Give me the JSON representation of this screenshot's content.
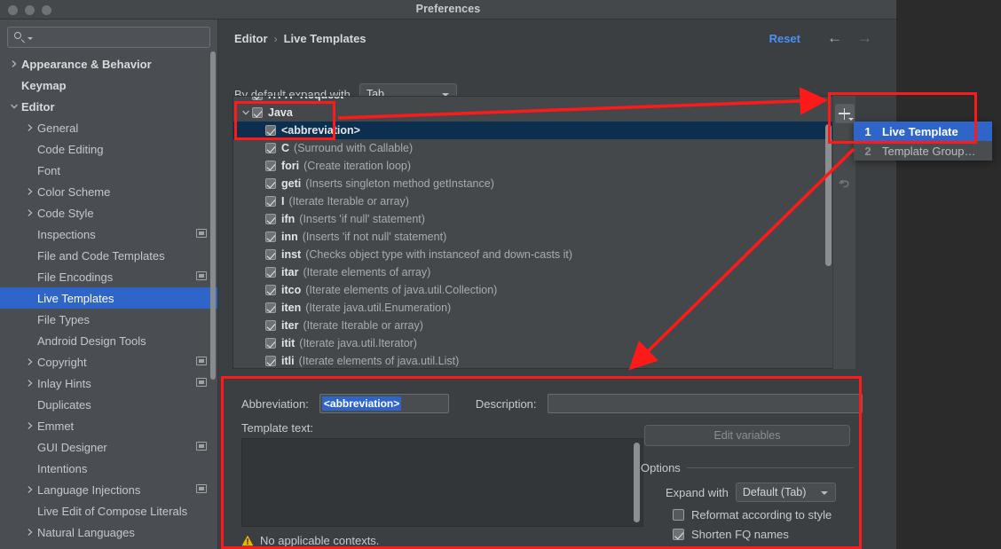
{
  "window": {
    "title": "Preferences"
  },
  "search": {
    "value": "",
    "placeholder": "",
    "icon": "search-icon"
  },
  "sidebar": {
    "items": [
      {
        "label": "Appearance & Behavior",
        "arrow": "right",
        "level": 0,
        "bold": true,
        "badge": false,
        "selected": false
      },
      {
        "label": "Keymap",
        "arrow": "none",
        "level": 0,
        "bold": true,
        "badge": false,
        "selected": false
      },
      {
        "label": "Editor",
        "arrow": "down",
        "level": 0,
        "bold": true,
        "badge": false,
        "selected": false
      },
      {
        "label": "General",
        "arrow": "right",
        "level": 1,
        "bold": false,
        "badge": false,
        "selected": false
      },
      {
        "label": "Code Editing",
        "arrow": "none",
        "level": 1,
        "bold": false,
        "badge": false,
        "selected": false
      },
      {
        "label": "Font",
        "arrow": "none",
        "level": 1,
        "bold": false,
        "badge": false,
        "selected": false
      },
      {
        "label": "Color Scheme",
        "arrow": "right",
        "level": 1,
        "bold": false,
        "badge": false,
        "selected": false
      },
      {
        "label": "Code Style",
        "arrow": "right",
        "level": 1,
        "bold": false,
        "badge": false,
        "selected": false
      },
      {
        "label": "Inspections",
        "arrow": "none",
        "level": 1,
        "bold": false,
        "badge": true,
        "selected": false
      },
      {
        "label": "File and Code Templates",
        "arrow": "none",
        "level": 1,
        "bold": false,
        "badge": false,
        "selected": false
      },
      {
        "label": "File Encodings",
        "arrow": "none",
        "level": 1,
        "bold": false,
        "badge": true,
        "selected": false
      },
      {
        "label": "Live Templates",
        "arrow": "none",
        "level": 1,
        "bold": false,
        "badge": false,
        "selected": true
      },
      {
        "label": "File Types",
        "arrow": "none",
        "level": 1,
        "bold": false,
        "badge": false,
        "selected": false
      },
      {
        "label": "Android Design Tools",
        "arrow": "none",
        "level": 1,
        "bold": false,
        "badge": false,
        "selected": false
      },
      {
        "label": "Copyright",
        "arrow": "right",
        "level": 1,
        "bold": false,
        "badge": true,
        "selected": false
      },
      {
        "label": "Inlay Hints",
        "arrow": "right",
        "level": 1,
        "bold": false,
        "badge": true,
        "selected": false
      },
      {
        "label": "Duplicates",
        "arrow": "none",
        "level": 1,
        "bold": false,
        "badge": false,
        "selected": false
      },
      {
        "label": "Emmet",
        "arrow": "right",
        "level": 1,
        "bold": false,
        "badge": false,
        "selected": false
      },
      {
        "label": "GUI Designer",
        "arrow": "none",
        "level": 1,
        "bold": false,
        "badge": true,
        "selected": false
      },
      {
        "label": "Intentions",
        "arrow": "none",
        "level": 1,
        "bold": false,
        "badge": false,
        "selected": false
      },
      {
        "label": "Language Injections",
        "arrow": "right",
        "level": 1,
        "bold": false,
        "badge": true,
        "selected": false
      },
      {
        "label": "Live Edit of Compose Literals",
        "arrow": "none",
        "level": 1,
        "bold": false,
        "badge": false,
        "selected": false
      },
      {
        "label": "Natural Languages",
        "arrow": "right",
        "level": 1,
        "bold": false,
        "badge": false,
        "selected": false
      }
    ]
  },
  "header": {
    "breadcrumb_root": "Editor",
    "breadcrumb_sep": "›",
    "breadcrumb_leaf": "Live Templates",
    "reset_label": "Reset",
    "back_arrow": "←",
    "forward_arrow": "→"
  },
  "expand": {
    "label": "By default expand with",
    "value": "Tab"
  },
  "templates": {
    "rows": [
      {
        "kind": "group",
        "label": "HTTP Request",
        "checked": true,
        "arrow": "down",
        "clipped": true,
        "selected": false
      },
      {
        "kind": "group",
        "label": "Java",
        "checked": true,
        "arrow": "down",
        "clipped": false,
        "selected": false
      },
      {
        "kind": "item",
        "abbr": "<abbreviation>",
        "desc": "",
        "checked": true,
        "selected": true
      },
      {
        "kind": "item",
        "abbr": "C",
        "desc": "(Surround with Callable)",
        "checked": true,
        "selected": false
      },
      {
        "kind": "item",
        "abbr": "fori",
        "desc": "(Create iteration loop)",
        "checked": true,
        "selected": false
      },
      {
        "kind": "item",
        "abbr": "geti",
        "desc": "(Inserts singleton method getInstance)",
        "checked": true,
        "selected": false
      },
      {
        "kind": "item",
        "abbr": "I",
        "desc": "(Iterate Iterable or array)",
        "checked": true,
        "selected": false
      },
      {
        "kind": "item",
        "abbr": "ifn",
        "desc": "(Inserts 'if null' statement)",
        "checked": true,
        "selected": false
      },
      {
        "kind": "item",
        "abbr": "inn",
        "desc": "(Inserts 'if not null' statement)",
        "checked": true,
        "selected": false
      },
      {
        "kind": "item",
        "abbr": "inst",
        "desc": "(Checks object type with instanceof and down-casts it)",
        "checked": true,
        "selected": false
      },
      {
        "kind": "item",
        "abbr": "itar",
        "desc": "(Iterate elements of array)",
        "checked": true,
        "selected": false
      },
      {
        "kind": "item",
        "abbr": "itco",
        "desc": "(Iterate elements of java.util.Collection)",
        "checked": true,
        "selected": false
      },
      {
        "kind": "item",
        "abbr": "iten",
        "desc": "(Iterate java.util.Enumeration)",
        "checked": true,
        "selected": false
      },
      {
        "kind": "item",
        "abbr": "iter",
        "desc": "(Iterate Iterable or array)",
        "checked": true,
        "selected": false
      },
      {
        "kind": "item",
        "abbr": "itit",
        "desc": "(Iterate java.util.Iterator)",
        "checked": true,
        "selected": false
      },
      {
        "kind": "item",
        "abbr": "itli",
        "desc": "(Iterate elements of java.util.List)",
        "checked": true,
        "selected": false
      }
    ]
  },
  "toolbar": {
    "add_icon": "plus-icon",
    "revert_icon": "revert-icon"
  },
  "popup": {
    "items": [
      {
        "num": "1",
        "label": "Live Template",
        "active": true
      },
      {
        "num": "2",
        "label": "Template Group…",
        "active": false
      }
    ]
  },
  "detail": {
    "abbreviation_label": "Abbreviation:",
    "abbreviation_value": "<abbreviation>",
    "description_label": "Description:",
    "description_value": "",
    "template_text_label": "Template text:",
    "template_text_value": "",
    "edit_variables_label": "Edit variables",
    "options_title": "Options",
    "expand_with_label": "Expand with",
    "expand_with_value": "Default (Tab)",
    "reformat_label": "Reformat according to style",
    "reformat_checked": false,
    "shorten_label": "Shorten FQ names",
    "shorten_checked": true,
    "warning_text": "No applicable contexts.",
    "warning_icon": "warning-icon"
  },
  "colors": {
    "accent_blue": "#2f65c9",
    "link_blue": "#4b8ff5",
    "annotation_red": "#ff1a1a",
    "panel_bg": "#3c3f41",
    "sidebar_bg": "#4a4e53",
    "selected_row": "#0d2f4f",
    "warning_yellow": "#f0b400"
  }
}
